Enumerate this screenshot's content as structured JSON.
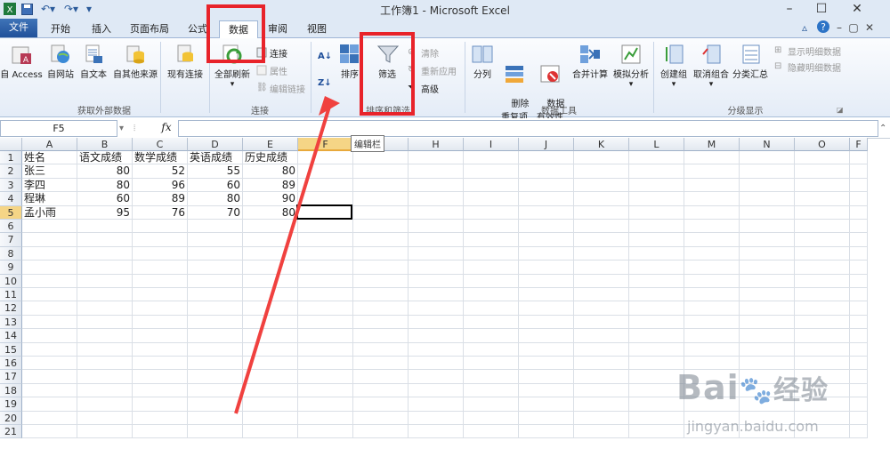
{
  "window": {
    "title": "工作簿1 - Microsoft Excel"
  },
  "tabs": [
    "开始",
    "插入",
    "页面布局",
    "公式",
    "数据",
    "审阅",
    "视图"
  ],
  "file_tab": "文件",
  "ribbon": {
    "get_external": {
      "label": "获取外部数据",
      "buttons": [
        "自 Access",
        "自网站",
        "自文本",
        "自其他来源",
        "现有连接"
      ]
    },
    "connections": {
      "label": "连接",
      "refresh_all": "全部刷新",
      "small": [
        "连接",
        "属性",
        "编辑链接"
      ]
    },
    "sort_filter": {
      "label": "排序和筛选",
      "sort": "排序",
      "filter": "筛选",
      "small": [
        "清除",
        "重新应用",
        "高级"
      ]
    },
    "data_tools": {
      "label": "数据工具",
      "buttons": [
        "分列",
        "删除\n重复项",
        "数据\n有效性",
        "合并计算",
        "模拟分析"
      ]
    },
    "outline": {
      "label": "分级显示",
      "buttons": [
        "创建组",
        "取消组合",
        "分类汇总"
      ],
      "small": [
        "显示明细数据",
        "隐藏明细数据"
      ]
    }
  },
  "formula_bar": {
    "name_box": "F5",
    "fx": "fx",
    "value": ""
  },
  "tooltip": "编辑栏",
  "columns": [
    "A",
    "B",
    "C",
    "D",
    "E",
    "F",
    "G",
    "H",
    "I",
    "J",
    "K",
    "L",
    "M",
    "N",
    "O",
    "F"
  ],
  "rows": [
    "1",
    "2",
    "3",
    "4",
    "5",
    "6",
    "7",
    "8",
    "9",
    "10",
    "11",
    "12",
    "13",
    "14",
    "15",
    "16",
    "17",
    "18",
    "19",
    "20",
    "21"
  ],
  "sheet": {
    "header": [
      "姓名",
      "语文成绩",
      "数学成绩",
      "英语成绩",
      "历史成绩"
    ],
    "data": [
      [
        "张三",
        "80",
        "52",
        "55",
        "80"
      ],
      [
        "李四",
        "80",
        "96",
        "60",
        "89"
      ],
      [
        "程琳",
        "60",
        "89",
        "80",
        "90"
      ],
      [
        "孟小雨",
        "95",
        "76",
        "70",
        "80"
      ]
    ]
  },
  "watermark": {
    "brand": "Bai",
    "brand2": "经验",
    "url": "jingyan.baidu.com"
  },
  "colors": {
    "accent": "#2b579a",
    "highlight": "#e8232a",
    "selected_header": "#f5d586"
  }
}
